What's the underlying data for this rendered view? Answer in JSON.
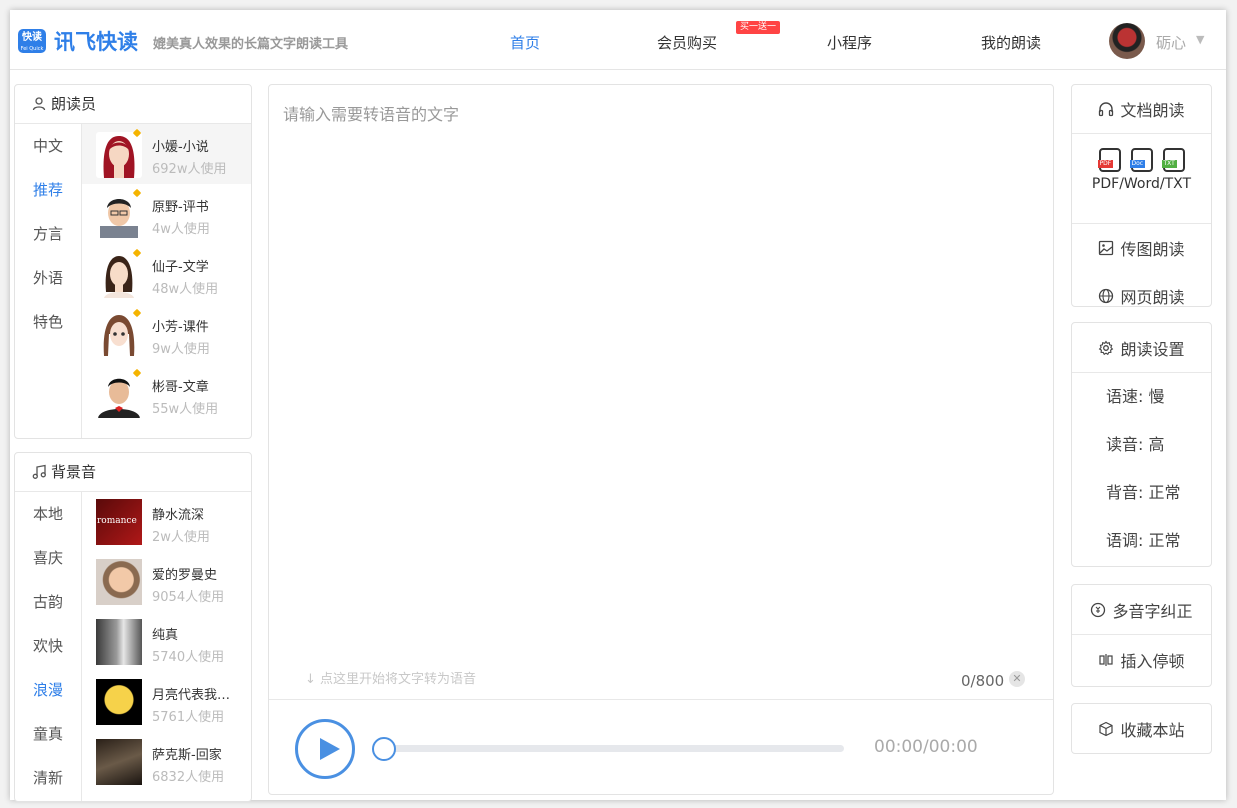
{
  "header": {
    "logo_badge": "快读",
    "logo_badge_sub": "Fei Quick",
    "logo_text": "讯飞快读",
    "slogan": "媲美真人效果的长篇文字朗读工具",
    "nav": [
      {
        "label": "首页",
        "active": true
      },
      {
        "label": "会员购买",
        "active": false
      },
      {
        "label": "小程序",
        "active": false
      },
      {
        "label": "我的朗读",
        "active": false
      }
    ],
    "promo_badge": "买一送一",
    "username": "砺心"
  },
  "readers_panel": {
    "title": "朗读员",
    "categories": [
      "中文",
      "推荐",
      "方言",
      "外语",
      "特色"
    ],
    "active_category": "推荐",
    "items": [
      {
        "name": "小媛-小说",
        "usage": "692w人使用",
        "selected": true
      },
      {
        "name": "原野-评书",
        "usage": "4w人使用",
        "selected": false
      },
      {
        "name": "仙子-文学",
        "usage": "48w人使用",
        "selected": false
      },
      {
        "name": "小芳-课件",
        "usage": "9w人使用",
        "selected": false
      },
      {
        "name": "彬哥-文章",
        "usage": "55w人使用",
        "selected": false
      }
    ]
  },
  "music_panel": {
    "title": "背景音",
    "categories": [
      "本地",
      "喜庆",
      "古韵",
      "欢快",
      "浪漫",
      "童真",
      "清新"
    ],
    "active_category": "浪漫",
    "items": [
      {
        "name": "静水流深",
        "usage": "2w人使用",
        "cover_text": "romance"
      },
      {
        "name": "爱的罗曼史",
        "usage": "9054人使用"
      },
      {
        "name": "纯真",
        "usage": "5740人使用"
      },
      {
        "name": "月亮代表我…",
        "usage": "5761人使用"
      },
      {
        "name": "萨克斯-回家",
        "usage": "6832人使用"
      }
    ]
  },
  "editor": {
    "placeholder": "请输入需要转语音的文字",
    "hint": "点这里开始将文字转为语音",
    "counter": "0/800",
    "time": "00:00/00:00",
    "progress": 0
  },
  "right": {
    "doc_read": "文档朗读",
    "file_types": [
      "PDF",
      "Doc",
      "TXT"
    ],
    "file_caption": "PDF/Word/TXT",
    "image_read": "传图朗读",
    "web_read": "网页朗读",
    "settings_title": "朗读设置",
    "settings": [
      "语速: 慢",
      "读音: 高",
      "背音: 正常",
      "语调: 正常"
    ],
    "polyphone": "多音字纠正",
    "pause": "插入停顿",
    "favorite": "收藏本站"
  },
  "colors": {
    "accent": "#2f7fe8",
    "promo": "#ff4444"
  }
}
